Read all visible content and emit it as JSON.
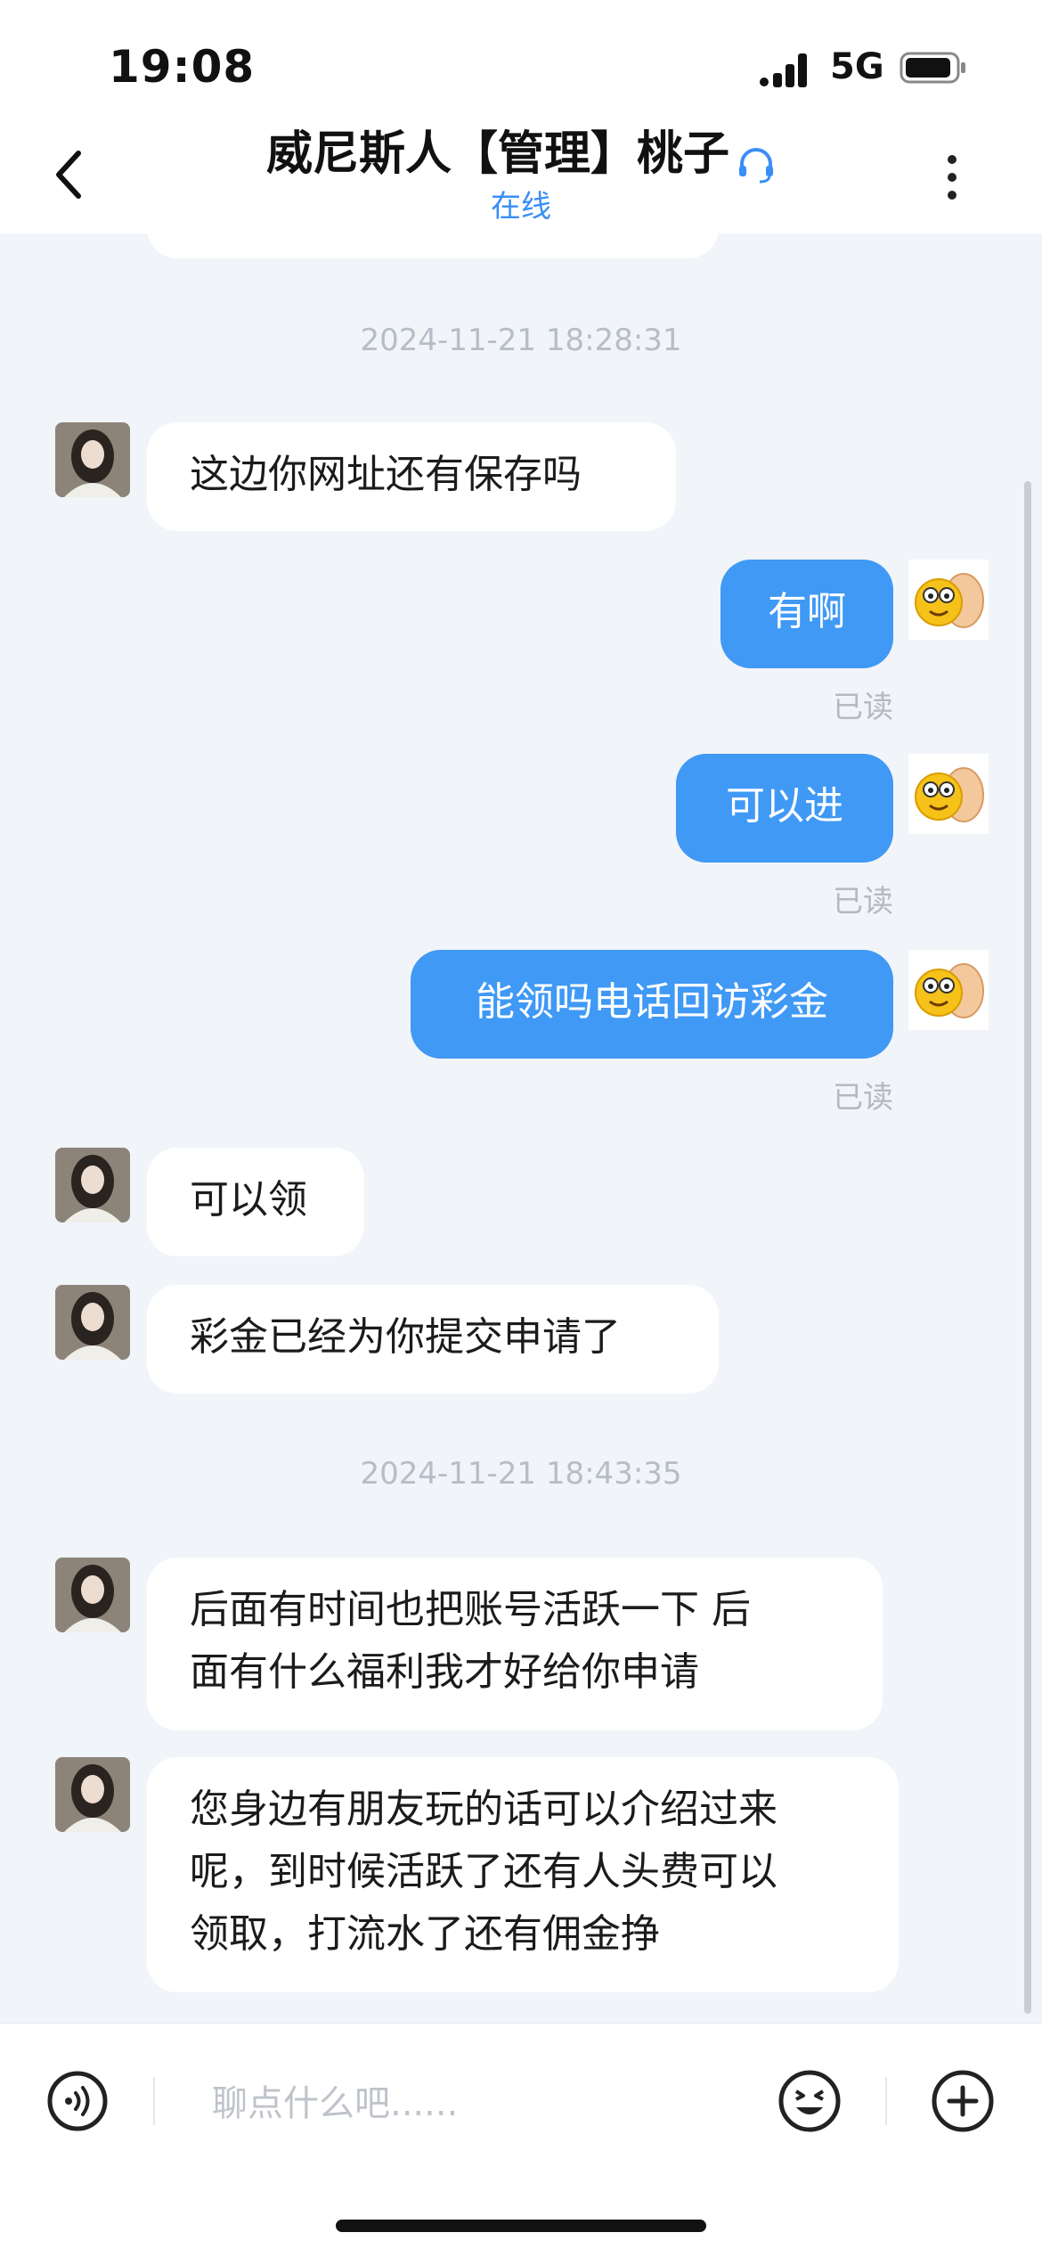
{
  "status_bar": {
    "time": "19:08",
    "network": "5G"
  },
  "header": {
    "title": "威尼斯人【管理】桃子",
    "status": "在线"
  },
  "messages": {
    "ts1": "2024-11-21 18:28:31",
    "m1": "这边你网址还有保存吗",
    "m2": "有啊",
    "m3": "可以进",
    "m4": "能领吗电话回访彩金",
    "read_label": "已读",
    "m5": "可以领",
    "m6": "彩金已经为你提交申请了",
    "ts2": "2024-11-21 18:43:35",
    "m7_line1": "后面有时间也把账号活跃一下  后",
    "m7_line2": "面有什么福利我才好给你申请",
    "m8_line1": "您身边有朋友玩的话可以介绍过来",
    "m8_line2": "呢，到时候活跃了还有人头费可以",
    "m8_line3": "领取，打流水了还有佣金挣"
  },
  "input": {
    "placeholder": "聊点什么吧......",
    "value": ""
  },
  "colors": {
    "accent": "#3f99f5",
    "online": "#3a8ef6",
    "background": "#f1f4f9"
  },
  "icons": [
    "back-icon",
    "headset-icon",
    "more-icon",
    "voice-icon",
    "emoji-icon",
    "plus-icon"
  ]
}
